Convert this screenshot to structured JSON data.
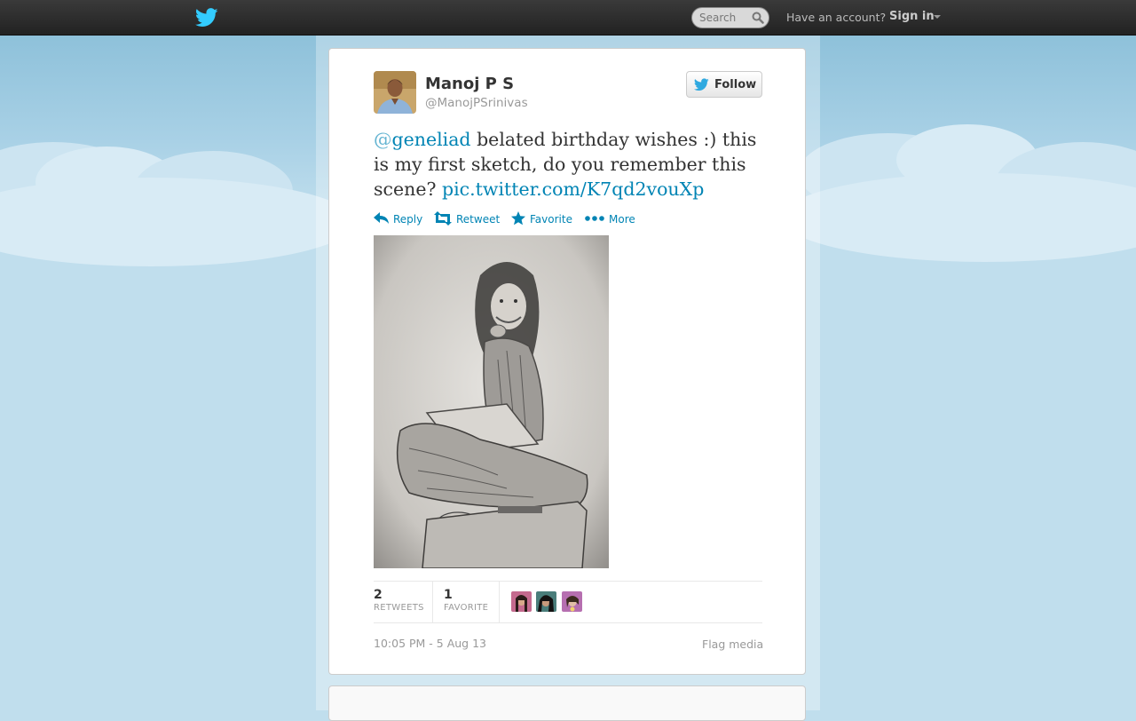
{
  "topbar": {
    "logo_icon": "twitter-bird-icon",
    "search_placeholder": "Search",
    "search_icon": "search-icon",
    "have_account": "Have an account?",
    "sign_in": "Sign in"
  },
  "tweet": {
    "author": {
      "fullname": "Manoj P S",
      "username": "@ManojPSrinivas"
    },
    "follow_label": "Follow",
    "text": {
      "mention_at": "@",
      "mention_name": "geneliad",
      "body": " belated birthday wishes :) this is my first sketch, do you remember this scene? ",
      "link": "pic.twitter.com/K7qd2vouXp"
    },
    "actions": {
      "reply": "Reply",
      "retweet": "Retweet",
      "favorite": "Favorite",
      "more": "More"
    },
    "stats": {
      "retweets_count": "2",
      "retweets_label": "RETWEETS",
      "favorites_count": "1",
      "favorites_label": "FAVORITE"
    },
    "timestamp": "10:05 PM - 5 Aug 13",
    "flag_media": "Flag media"
  },
  "colors": {
    "link": "#0084b4",
    "sky": "#c0deed",
    "topbar": "#222222"
  }
}
